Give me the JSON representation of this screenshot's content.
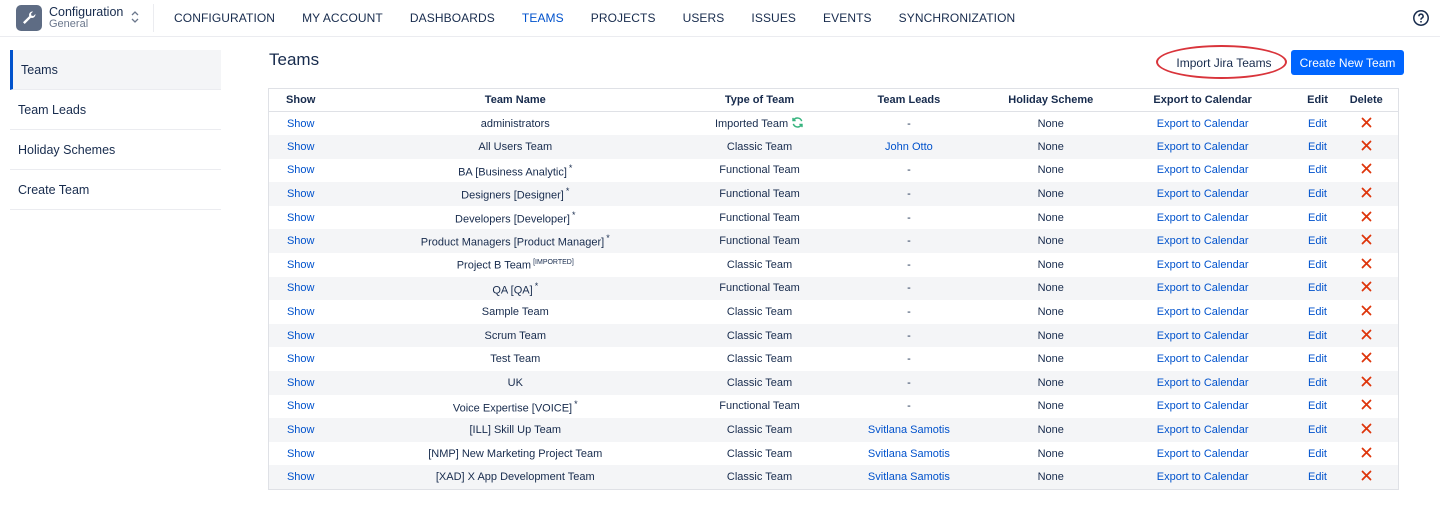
{
  "app": {
    "title": "Configuration",
    "subtitle": "General"
  },
  "nav": [
    "CONFIGURATION",
    "MY ACCOUNT",
    "DASHBOARDS",
    "TEAMS",
    "PROJECTS",
    "USERS",
    "ISSUES",
    "EVENTS",
    "SYNCHRONIZATION"
  ],
  "nav_active": "TEAMS",
  "sidebar": {
    "items": [
      "Teams",
      "Team Leads",
      "Holiday Schemes",
      "Create Team"
    ]
  },
  "page": {
    "title": "Teams",
    "import_label": "Import Jira Teams",
    "create_label": "Create New Team"
  },
  "table": {
    "headers": [
      "Show",
      "Team Name",
      "Type of Team",
      "Team Leads",
      "Holiday Scheme",
      "Export to Calendar",
      "Edit",
      "Delete"
    ],
    "rows": [
      {
        "show": "Show",
        "name": "administrators",
        "suffix": "",
        "type": "Imported Team",
        "synced": true,
        "lead": "-",
        "lead_link": false,
        "holiday": "None",
        "export": "Export to Calendar",
        "edit": "Edit"
      },
      {
        "show": "Show",
        "name": "All Users Team",
        "suffix": "",
        "type": "Classic Team",
        "synced": false,
        "lead": "John Otto",
        "lead_link": true,
        "holiday": "None",
        "export": "Export to Calendar",
        "edit": "Edit"
      },
      {
        "show": "Show",
        "name": "BA [Business Analytic]",
        "suffix": "*",
        "type": "Functional Team",
        "synced": false,
        "lead": "-",
        "lead_link": false,
        "holiday": "None",
        "export": "Export to Calendar",
        "edit": "Edit"
      },
      {
        "show": "Show",
        "name": "Designers [Designer]",
        "suffix": "*",
        "type": "Functional Team",
        "synced": false,
        "lead": "-",
        "lead_link": false,
        "holiday": "None",
        "export": "Export to Calendar",
        "edit": "Edit"
      },
      {
        "show": "Show",
        "name": "Developers [Developer]",
        "suffix": "*",
        "type": "Functional Team",
        "synced": false,
        "lead": "-",
        "lead_link": false,
        "holiday": "None",
        "export": "Export to Calendar",
        "edit": "Edit"
      },
      {
        "show": "Show",
        "name": "Product Managers [Product Manager]",
        "suffix": "*",
        "type": "Functional Team",
        "synced": false,
        "lead": "-",
        "lead_link": false,
        "holiday": "None",
        "export": "Export to Calendar",
        "edit": "Edit"
      },
      {
        "show": "Show",
        "name": "Project B Team",
        "suffix": "[IMPORTED]",
        "type": "Classic Team",
        "synced": false,
        "lead": "-",
        "lead_link": false,
        "holiday": "None",
        "export": "Export to Calendar",
        "edit": "Edit"
      },
      {
        "show": "Show",
        "name": "QA [QA]",
        "suffix": "*",
        "type": "Functional Team",
        "synced": false,
        "lead": "-",
        "lead_link": false,
        "holiday": "None",
        "export": "Export to Calendar",
        "edit": "Edit"
      },
      {
        "show": "Show",
        "name": "Sample Team",
        "suffix": "",
        "type": "Classic Team",
        "synced": false,
        "lead": "-",
        "lead_link": false,
        "holiday": "None",
        "export": "Export to Calendar",
        "edit": "Edit"
      },
      {
        "show": "Show",
        "name": "Scrum Team",
        "suffix": "",
        "type": "Classic Team",
        "synced": false,
        "lead": "-",
        "lead_link": false,
        "holiday": "None",
        "export": "Export to Calendar",
        "edit": "Edit"
      },
      {
        "show": "Show",
        "name": "Test Team",
        "suffix": "",
        "type": "Classic Team",
        "synced": false,
        "lead": "-",
        "lead_link": false,
        "holiday": "None",
        "export": "Export to Calendar",
        "edit": "Edit"
      },
      {
        "show": "Show",
        "name": "UK",
        "suffix": "",
        "type": "Classic Team",
        "synced": false,
        "lead": "-",
        "lead_link": false,
        "holiday": "None",
        "export": "Export to Calendar",
        "edit": "Edit"
      },
      {
        "show": "Show",
        "name": "Voice Expertise [VOICE]",
        "suffix": "*",
        "type": "Functional Team",
        "synced": false,
        "lead": "-",
        "lead_link": false,
        "holiday": "None",
        "export": "Export to Calendar",
        "edit": "Edit"
      },
      {
        "show": "Show",
        "name": "[ILL] Skill Up Team",
        "suffix": "",
        "type": "Classic Team",
        "synced": false,
        "lead": "Svitlana Samotis",
        "lead_link": true,
        "holiday": "None",
        "export": "Export to Calendar",
        "edit": "Edit"
      },
      {
        "show": "Show",
        "name": "[NMP] New Marketing Project Team",
        "suffix": "",
        "type": "Classic Team",
        "synced": false,
        "lead": "Svitlana Samotis",
        "lead_link": true,
        "holiday": "None",
        "export": "Export to Calendar",
        "edit": "Edit"
      },
      {
        "show": "Show",
        "name": "[XAD] X App Development Team",
        "suffix": "",
        "type": "Classic Team",
        "synced": false,
        "lead": "Svitlana Samotis",
        "lead_link": true,
        "holiday": "None",
        "export": "Export to Calendar",
        "edit": "Edit"
      }
    ]
  },
  "icons": {
    "app": "wrench-icon",
    "switch": "chevron-updown-icon",
    "help": "help-icon",
    "sync": "sync-icon",
    "delete": "delete-x-icon"
  },
  "colors": {
    "link": "#0052cc",
    "primary_button": "#0065ff",
    "annotation": "#d9343b",
    "delete": "#de350b",
    "sync": "#36b37e"
  }
}
